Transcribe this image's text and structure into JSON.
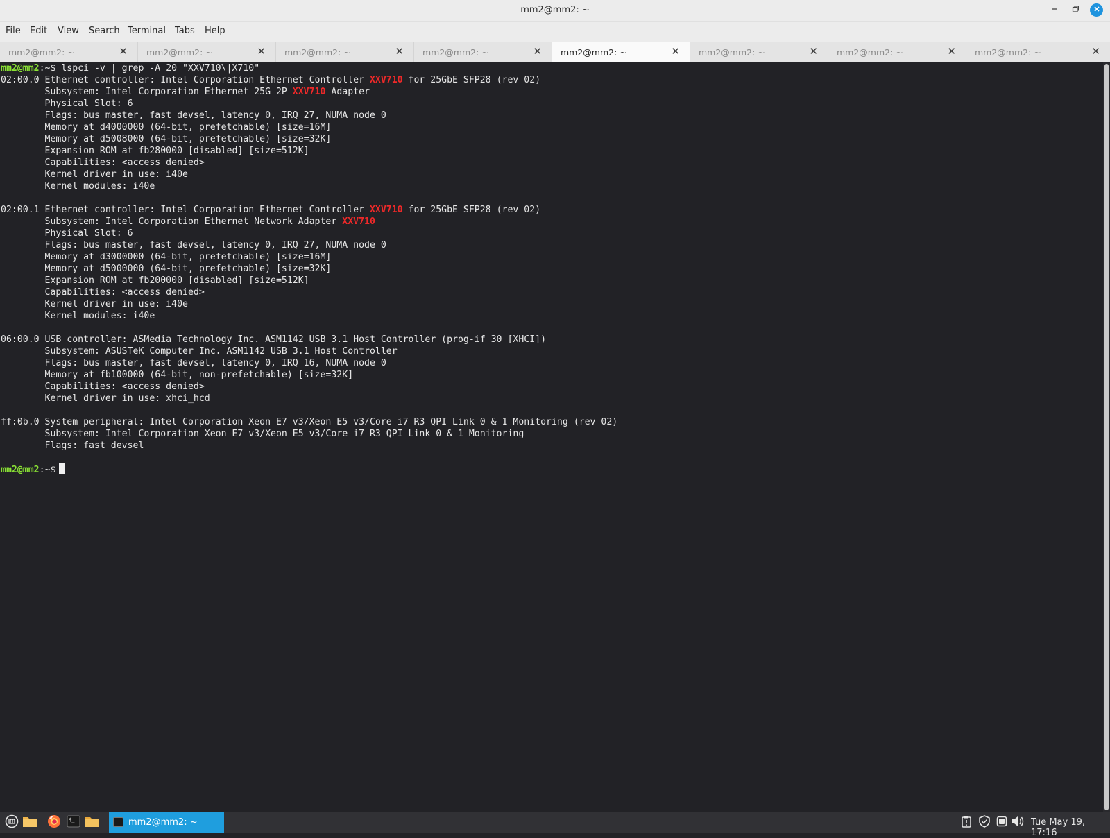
{
  "window": {
    "title": "mm2@mm2: ~",
    "icons": [
      "minimize-icon",
      "maximize-icon",
      "close-icon"
    ]
  },
  "menu": [
    "File",
    "Edit",
    "View",
    "Search",
    "Terminal",
    "Tabs",
    "Help"
  ],
  "tabs": [
    {
      "label": "mm2@mm2: ~",
      "active": false
    },
    {
      "label": "mm2@mm2: ~",
      "active": false
    },
    {
      "label": "mm2@mm2: ~",
      "active": false
    },
    {
      "label": "mm2@mm2: ~",
      "active": false
    },
    {
      "label": "mm2@mm2: ~",
      "active": true
    },
    {
      "label": "mm2@mm2: ~",
      "active": false
    },
    {
      "label": "mm2@mm2: ~",
      "active": false
    },
    {
      "label": "mm2@mm2: ~",
      "active": false
    }
  ],
  "terminal": {
    "colors": {
      "prompt": "#8ae234",
      "highlight": "#ef2929",
      "text": "#e6e6e6",
      "background": "#222226"
    },
    "lines": [
      [
        {
          "t": "mm2@mm2",
          "s": "prompt"
        },
        {
          "t": ":~$ lspci -v | grep -A 20 \"XXV710\\|X710\""
        }
      ],
      [
        {
          "t": "02:00.0 Ethernet controller: Intel Corporation Ethernet Controller "
        },
        {
          "t": "XXV710",
          "s": "hl"
        },
        {
          "t": " for 25GbE SFP28 (rev 02)"
        }
      ],
      [
        {
          "t": "        Subsystem: Intel Corporation Ethernet 25G 2P "
        },
        {
          "t": "XXV710",
          "s": "hl"
        },
        {
          "t": " Adapter"
        }
      ],
      [
        {
          "t": "        Physical Slot: 6"
        }
      ],
      [
        {
          "t": "        Flags: bus master, fast devsel, latency 0, IRQ 27, NUMA node 0"
        }
      ],
      [
        {
          "t": "        Memory at d4000000 (64-bit, prefetchable) [size=16M]"
        }
      ],
      [
        {
          "t": "        Memory at d5008000 (64-bit, prefetchable) [size=32K]"
        }
      ],
      [
        {
          "t": "        Expansion ROM at fb280000 [disabled] [size=512K]"
        }
      ],
      [
        {
          "t": "        Capabilities: <access denied>"
        }
      ],
      [
        {
          "t": "        Kernel driver in use: i40e"
        }
      ],
      [
        {
          "t": "        Kernel modules: i40e"
        }
      ],
      [
        {
          "t": ""
        }
      ],
      [
        {
          "t": "02:00.1 Ethernet controller: Intel Corporation Ethernet Controller "
        },
        {
          "t": "XXV710",
          "s": "hl"
        },
        {
          "t": " for 25GbE SFP28 (rev 02)"
        }
      ],
      [
        {
          "t": "        Subsystem: Intel Corporation Ethernet Network Adapter "
        },
        {
          "t": "XXV710",
          "s": "hl"
        }
      ],
      [
        {
          "t": "        Physical Slot: 6"
        }
      ],
      [
        {
          "t": "        Flags: bus master, fast devsel, latency 0, IRQ 27, NUMA node 0"
        }
      ],
      [
        {
          "t": "        Memory at d3000000 (64-bit, prefetchable) [size=16M]"
        }
      ],
      [
        {
          "t": "        Memory at d5000000 (64-bit, prefetchable) [size=32K]"
        }
      ],
      [
        {
          "t": "        Expansion ROM at fb200000 [disabled] [size=512K]"
        }
      ],
      [
        {
          "t": "        Capabilities: <access denied>"
        }
      ],
      [
        {
          "t": "        Kernel driver in use: i40e"
        }
      ],
      [
        {
          "t": "        Kernel modules: i40e"
        }
      ],
      [
        {
          "t": ""
        }
      ],
      [
        {
          "t": "06:00.0 USB controller: ASMedia Technology Inc. ASM1142 USB 3.1 Host Controller (prog-if 30 [XHCI])"
        }
      ],
      [
        {
          "t": "        Subsystem: ASUSTeK Computer Inc. ASM1142 USB 3.1 Host Controller"
        }
      ],
      [
        {
          "t": "        Flags: bus master, fast devsel, latency 0, IRQ 16, NUMA node 0"
        }
      ],
      [
        {
          "t": "        Memory at fb100000 (64-bit, non-prefetchable) [size=32K]"
        }
      ],
      [
        {
          "t": "        Capabilities: <access denied>"
        }
      ],
      [
        {
          "t": "        Kernel driver in use: xhci_hcd"
        }
      ],
      [
        {
          "t": ""
        }
      ],
      [
        {
          "t": "ff:0b.0 System peripheral: Intel Corporation Xeon E7 v3/Xeon E5 v3/Core i7 R3 QPI Link 0 & 1 Monitoring (rev 02)"
        }
      ],
      [
        {
          "t": "        Subsystem: Intel Corporation Xeon E7 v3/Xeon E5 v3/Core i7 R3 QPI Link 0 & 1 Monitoring"
        }
      ],
      [
        {
          "t": "        Flags: fast devsel"
        }
      ],
      [
        {
          "t": ""
        }
      ],
      [
        {
          "t": "mm2@mm2",
          "s": "prompt"
        },
        {
          "t": ":~$"
        },
        {
          "t": "",
          "s": "cursor"
        }
      ]
    ]
  },
  "taskbar": {
    "launchers": [
      "mint-menu-icon",
      "files-folder-icon",
      "firefox-icon",
      "terminal-icon",
      "folder-icon"
    ],
    "active_window": {
      "label": "mm2@mm2: ~",
      "icon": "terminal-icon"
    },
    "tray": [
      "clipboard-icon",
      "shield-icon",
      "removable-drive-icon",
      "volume-icon"
    ],
    "clock": "Tue May 19, 17:16"
  }
}
